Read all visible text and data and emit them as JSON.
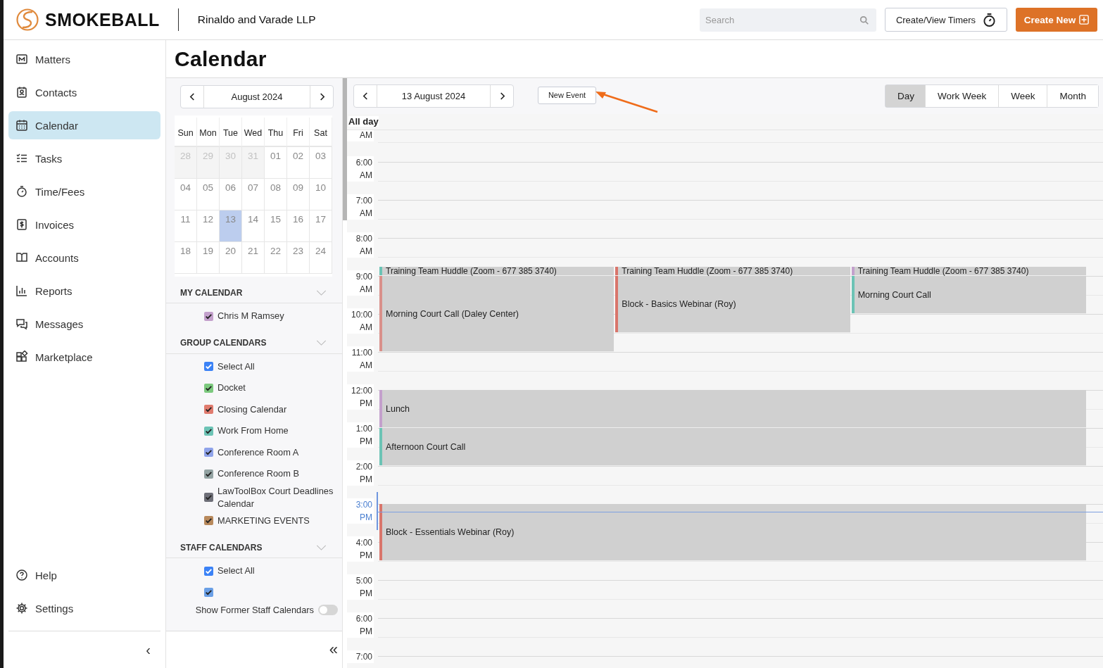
{
  "header": {
    "logo": "SMOKEBALL",
    "firm": "Rinaldo and Varade LLP",
    "search": {
      "placeholder": "Search"
    },
    "timers_button": "Create/View Timers",
    "create_button": "Create New"
  },
  "sidebar": {
    "items": [
      {
        "label": "Matters",
        "selected": false
      },
      {
        "label": "Contacts",
        "selected": false
      },
      {
        "label": "Calendar",
        "selected": true
      },
      {
        "label": "Tasks",
        "selected": false
      },
      {
        "label": "Time/Fees",
        "selected": false
      },
      {
        "label": "Invoices",
        "selected": false
      },
      {
        "label": "Accounts",
        "selected": false
      },
      {
        "label": "Reports",
        "selected": false
      },
      {
        "label": "Messages",
        "selected": false
      },
      {
        "label": "Marketplace",
        "selected": false
      }
    ],
    "bottom_items": [
      {
        "label": "Help"
      },
      {
        "label": "Settings"
      }
    ],
    "collapse": "‹"
  },
  "page_title": "Calendar",
  "mini_calendar": {
    "month": "August 2024",
    "weekdays": [
      "Sun",
      "Mon",
      "Tue",
      "Wed",
      "Thu",
      "Fri",
      "Sat"
    ],
    "weeks": [
      [
        {
          "day": "28",
          "outside": true,
          "selected": false
        },
        {
          "day": "29",
          "outside": true,
          "selected": false
        },
        {
          "day": "30",
          "outside": true,
          "selected": false
        },
        {
          "day": "31",
          "outside": true,
          "selected": false
        },
        {
          "day": "01",
          "outside": false,
          "selected": false
        },
        {
          "day": "02",
          "outside": false,
          "selected": false
        },
        {
          "day": "03",
          "outside": false,
          "selected": false
        }
      ],
      [
        {
          "day": "04",
          "outside": false,
          "selected": false
        },
        {
          "day": "05",
          "outside": false,
          "selected": false
        },
        {
          "day": "06",
          "outside": false,
          "selected": false
        },
        {
          "day": "07",
          "outside": false,
          "selected": false
        },
        {
          "day": "08",
          "outside": false,
          "selected": false
        },
        {
          "day": "09",
          "outside": false,
          "selected": false
        },
        {
          "day": "10",
          "outside": false,
          "selected": false
        }
      ],
      [
        {
          "day": "11",
          "outside": false,
          "selected": false
        },
        {
          "day": "12",
          "outside": false,
          "selected": false
        },
        {
          "day": "13",
          "outside": false,
          "selected": true
        },
        {
          "day": "14",
          "outside": false,
          "selected": false
        },
        {
          "day": "15",
          "outside": false,
          "selected": false
        },
        {
          "day": "16",
          "outside": false,
          "selected": false
        },
        {
          "day": "17",
          "outside": false,
          "selected": false
        }
      ],
      [
        {
          "day": "18",
          "outside": false,
          "selected": false
        },
        {
          "day": "19",
          "outside": false,
          "selected": false
        },
        {
          "day": "20",
          "outside": false,
          "selected": false
        },
        {
          "day": "21",
          "outside": false,
          "selected": false
        },
        {
          "day": "22",
          "outside": false,
          "selected": false
        },
        {
          "day": "23",
          "outside": false,
          "selected": false
        },
        {
          "day": "24",
          "outside": false,
          "selected": false
        }
      ]
    ]
  },
  "calendar_sections": [
    {
      "title": "MY CALENDAR",
      "items": [
        {
          "label": "Chris M Ramsey",
          "checked": true,
          "color": "#c3a0cc"
        }
      ]
    },
    {
      "title": "GROUP CALENDARS",
      "items": [
        {
          "label": "Select All",
          "checked": true,
          "color": "#3b82f6"
        },
        {
          "label": "Docket",
          "checked": true,
          "color": "#7cc97e"
        },
        {
          "label": "Closing Calendar",
          "checked": true,
          "color": "#e07b6e"
        },
        {
          "label": "Work From Home",
          "checked": true,
          "color": "#6cc3b5"
        },
        {
          "label": "Conference Room A",
          "checked": true,
          "color": "#8fa3ea"
        },
        {
          "label": "Conference Room B",
          "checked": true,
          "color": "#93a3a3"
        },
        {
          "label": "LawToolBox Court Deadlines Calendar",
          "checked": true,
          "color": "#6e6f78"
        },
        {
          "label": "MARKETING EVENTS",
          "checked": true,
          "color": "#b8895c"
        }
      ]
    },
    {
      "title": "STAFF CALENDARS",
      "items": [
        {
          "label": "Select All",
          "checked": true,
          "color": "#3b82f6"
        },
        {
          "checked": true,
          "color": "#6a9fe6"
        }
      ]
    }
  ],
  "former_staff_toggle": {
    "label": "Show Former Staff Calendars",
    "on": false
  },
  "panel_collapse": "«",
  "day_view": {
    "date": "13 August 2024",
    "new_event_button": "New Event",
    "views": [
      {
        "label": "Day",
        "selected": true
      },
      {
        "label": "Work Week",
        "selected": false
      },
      {
        "label": "Week",
        "selected": false
      },
      {
        "label": "Month",
        "selected": false
      }
    ],
    "all_day_label": "All day",
    "slots": [
      {
        "period": "AM",
        "current": false
      },
      {
        "time": "6:00",
        "period": "AM",
        "current": false
      },
      {
        "time": "7:00",
        "period": "AM",
        "current": false
      },
      {
        "time": "8:00",
        "period": "AM",
        "current": false
      },
      {
        "time": "9:00",
        "period": "AM",
        "current": false
      },
      {
        "time": "10:00",
        "period": "AM",
        "current": false
      },
      {
        "time": "11:00",
        "period": "AM",
        "current": false
      },
      {
        "time": "12:00",
        "period": "PM",
        "current": false
      },
      {
        "time": "1:00",
        "period": "PM",
        "current": false
      },
      {
        "time": "2:00",
        "period": "PM",
        "current": false
      },
      {
        "time": "3:00",
        "period": "PM",
        "current": true
      },
      {
        "time": "4:00",
        "period": "PM",
        "current": false
      },
      {
        "time": "5:00",
        "period": "PM",
        "current": false
      },
      {
        "time": "6:00",
        "period": "PM",
        "current": false
      },
      {
        "time": "7:00",
        "current": false
      }
    ],
    "event_groups": [
      {
        "lanes": [
          [
            {
              "title": "Training Team Huddle (Zoom - 677 385 3740)",
              "color": "#6cc3b5"
            },
            {
              "title": "Morning Court Call (Daley Center)",
              "color": "#d9908a"
            }
          ],
          [
            {
              "title": "Training Team Huddle (Zoom - 677 385 3740)",
              "color": "#d9756b"
            },
            {
              "title": "Block - Basics Webinar (Roy)",
              "color": "#d9756b"
            }
          ],
          [
            {
              "title": "Training Team Huddle (Zoom - 677 385 3740)",
              "color": "#c3a0cc"
            },
            {
              "title": "Morning Court Call",
              "color": "#6cc3b5"
            }
          ]
        ]
      },
      {
        "lanes": [
          [
            {
              "title": "Lunch",
              "color": "#c3a0cc"
            },
            {
              "title": "Afternoon Court Call",
              "color": "#6cc3b5"
            },
            {
              "title": "Block - Essentials Webinar (Roy)",
              "color": "#d9756b"
            }
          ]
        ]
      }
    ]
  }
}
